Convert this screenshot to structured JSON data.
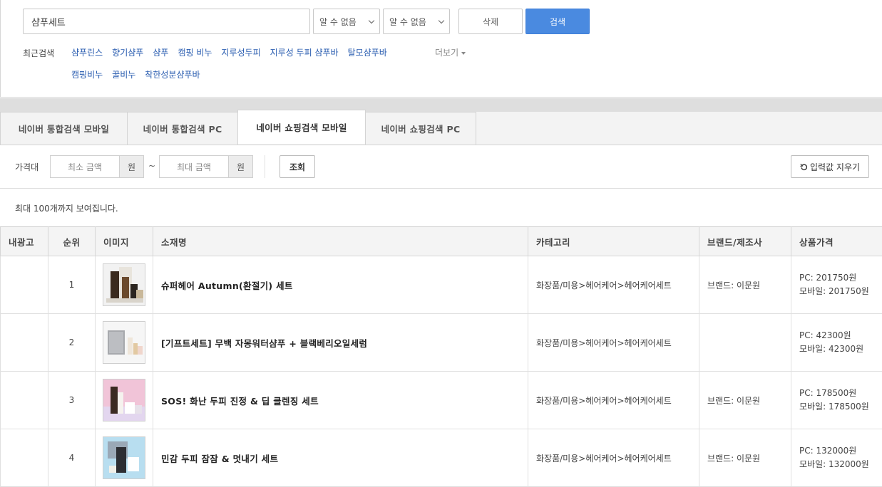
{
  "search": {
    "query": "샴푸세트",
    "select1": "알 수 없음",
    "select2": "알 수 없음",
    "delete_label": "삭제",
    "search_label": "검색"
  },
  "recent": {
    "label": "최근검색",
    "items": [
      "샴푸린스",
      "향기샴푸",
      "샴푸",
      "캠핑 비누",
      "지루성두피",
      "지루성 두피 샴푸바",
      "탈모샴푸바",
      "캠핑비누",
      "꿀비누",
      "착한성분샴푸바"
    ],
    "more_label": "더보기"
  },
  "tabs": [
    {
      "label": "네이버 통합검색 모바일"
    },
    {
      "label": "네이버 통합검색 PC"
    },
    {
      "label": "네이버 쇼핑검색 모바일"
    },
    {
      "label": "네이버 쇼핑검색 PC"
    }
  ],
  "filter": {
    "price_label": "가격대",
    "min_placeholder": "최소 금액",
    "max_placeholder": "최대 금액",
    "unit": "원",
    "tilde": "~",
    "query_label": "조회",
    "clear_label": "입력값 지우기"
  },
  "note": "최대 100개까지 보여집니다.",
  "table": {
    "headers": [
      "내광고",
      "순위",
      "이미지",
      "소재명",
      "카테고리",
      "브랜드/제조사",
      "상품가격"
    ],
    "rows": [
      {
        "rank": "1",
        "name": "슈퍼헤어 Autumn(환절기) 세트",
        "category": "화장품/미용>헤어케어>헤어케어세트",
        "brand": "브랜드: 이문원",
        "pc": "PC: 201750원",
        "mobile": "모바일: 201750원",
        "thumb_bg": "#f2f2f2"
      },
      {
        "rank": "2",
        "name": "[기프트세트] 무백 자몽워터샴푸 + 블랙베리오일세럼",
        "category": "화장품/미용>헤어케어>헤어케어세트",
        "brand": "",
        "pc": "PC: 42300원",
        "mobile": "모바일: 42300원",
        "thumb_bg": "#f6f6f6"
      },
      {
        "rank": "3",
        "name": "SOS! 화난 두피 진정 & 딥 클렌징 세트",
        "category": "화장품/미용>헤어케어>헤어케어세트",
        "brand": "브랜드: 이문원",
        "pc": "PC: 178500원",
        "mobile": "모바일: 178500원",
        "thumb_bg": "#f4c9dc"
      },
      {
        "rank": "4",
        "name": "민감 두피 잠잠 & 멋내기 세트",
        "category": "화장품/미용>헤어케어>헤어케어세트",
        "brand": "브랜드: 이문원",
        "pc": "PC: 132000원",
        "mobile": "모바일: 132000원",
        "thumb_bg": "#bfe3f2"
      }
    ]
  }
}
